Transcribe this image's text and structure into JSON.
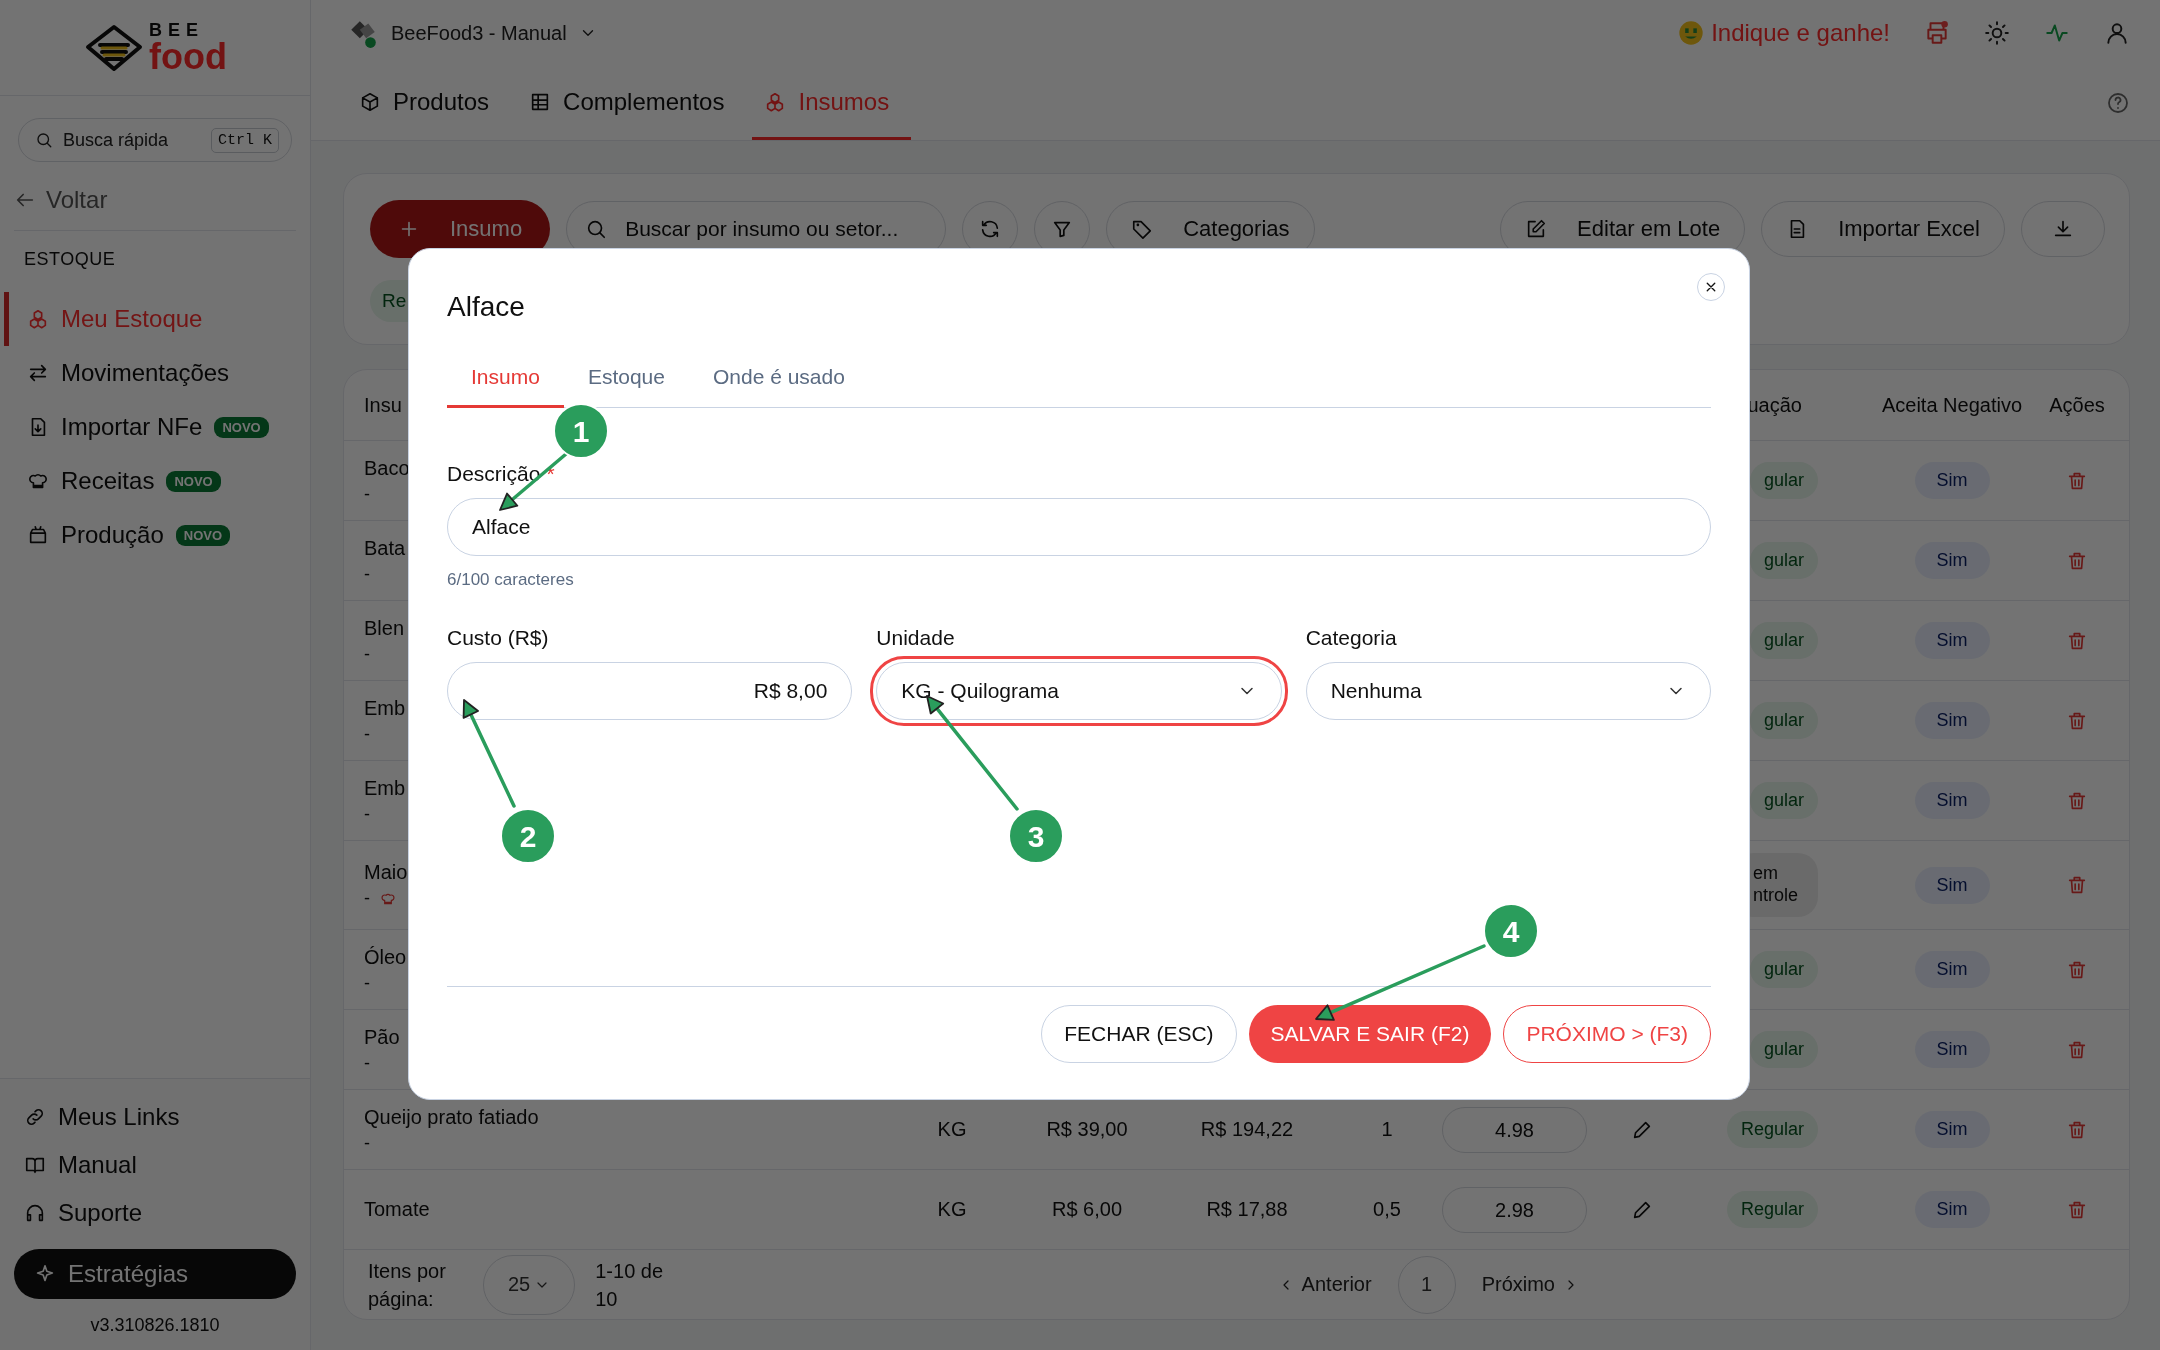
{
  "logo": {
    "top": "BEE",
    "bottom": "food"
  },
  "sidebar": {
    "search": {
      "placeholder": "Busca rápida",
      "shortcut": "Ctrl K"
    },
    "back": "Voltar",
    "section": "ESTOQUE",
    "items": [
      {
        "label": "Meu Estoque",
        "selected": true
      },
      {
        "label": "Movimentações",
        "selected": false
      },
      {
        "label": "Importar NFe",
        "badge": "NOVO",
        "selected": false
      },
      {
        "label": "Receitas",
        "badge": "NOVO",
        "selected": false
      },
      {
        "label": "Produção",
        "badge": "NOVO",
        "selected": false
      }
    ],
    "links": [
      {
        "label": "Meus Links"
      },
      {
        "label": "Manual"
      },
      {
        "label": "Suporte"
      }
    ],
    "cta": "Estratégias",
    "version": "v3.310826.1810"
  },
  "topbar": {
    "store": "BeeFood3 - Manual",
    "store_online": true,
    "referral": "Indique e ganhe!",
    "printer_alert": true
  },
  "tabs": [
    {
      "label": "Produtos",
      "selected": false
    },
    {
      "label": "Complementos",
      "selected": false
    },
    {
      "label": "Insumos",
      "selected": true
    }
  ],
  "toolbar": {
    "add_button": "Insumo",
    "search_placeholder": "Buscar por insumo ou setor...",
    "categories": "Categorias",
    "batch_edit": "Editar em Lote",
    "import": "Importar Excel",
    "chip": "Re"
  },
  "table": {
    "headers": {
      "column_1": "Insu",
      "column_8": "uação",
      "negative": "Aceita Negativo",
      "actions": "Ações"
    },
    "rows": [
      {
        "name": "Baco",
        "detail": "-",
        "status": {
          "text": "gular",
          "kind": "regular"
        },
        "negative": "Sim"
      },
      {
        "name": "Bata",
        "detail": "-",
        "status": {
          "text": "gular",
          "kind": "regular"
        },
        "negative": "Sim"
      },
      {
        "name": "Blen",
        "detail": "-",
        "status": {
          "text": "gular",
          "kind": "regular"
        },
        "negative": "Sim"
      },
      {
        "name": "Emb",
        "detail": "-",
        "status": {
          "text": "gular",
          "kind": "regular"
        },
        "negative": "Sim"
      },
      {
        "name": "Emb",
        "detail": "-",
        "status": {
          "text": "gular",
          "kind": "regular"
        },
        "negative": "Sim"
      },
      {
        "name": "Maio",
        "detail": "-",
        "recipe": true,
        "status": {
          "text": "em\nntrole",
          "kind": "none"
        },
        "negative": "Sim"
      },
      {
        "name": "Óleo",
        "detail": "-",
        "status": {
          "text": "gular",
          "kind": "regular"
        },
        "negative": "Sim"
      },
      {
        "name": "Pão",
        "detail": "-",
        "status": {
          "text": "gular",
          "kind": "regular"
        },
        "negative": "Sim"
      },
      {
        "name": "Queijo prato fatiado",
        "detail": "-",
        "unit": "KG",
        "cost": "R$ 39,00",
        "total": "R$ 194,22",
        "qty": "1",
        "stock": "4.98",
        "status": {
          "text": "Regular",
          "kind": "regular"
        },
        "negative": "Sim"
      },
      {
        "name": "Tomate",
        "unit": "KG",
        "cost": "R$ 6,00",
        "total": "R$ 17,88",
        "qty": "0,5",
        "stock": "2.98",
        "status": {
          "text": "Regular",
          "kind": "regular"
        },
        "negative": "Sim"
      }
    ]
  },
  "pagination": {
    "per_page_label": "Itens por página:",
    "per_page": "25",
    "range": "1-10 de 10",
    "prev": "Anterior",
    "page": "1",
    "next": "Próximo"
  },
  "modal": {
    "title": "Alface",
    "tabs": [
      {
        "label": "Insumo",
        "selected": true
      },
      {
        "label": "Estoque",
        "selected": false
      },
      {
        "label": "Onde é usado",
        "selected": false
      }
    ],
    "description": {
      "label": "Descrição",
      "required_mark": "*",
      "value": "Alface",
      "hint": "6/100 caracteres"
    },
    "fields": [
      {
        "label": "Custo (R$)",
        "kind": "money",
        "value": "R$ 8,00",
        "highlighted": false
      },
      {
        "label": "Unidade",
        "kind": "select",
        "value": "KG - Quilograma",
        "highlighted": true
      },
      {
        "label": "Categoria",
        "kind": "select",
        "value": "Nenhuma",
        "highlighted": false
      }
    ],
    "buttons": [
      {
        "label": "FECHAR (ESC)",
        "kind": "secondary"
      },
      {
        "label": "SALVAR E SAIR (F2)",
        "kind": "primary"
      },
      {
        "label": "PRÓXIMO > (F3)",
        "kind": "outline"
      }
    ]
  },
  "annotations": [
    {
      "label": "1"
    },
    {
      "label": "2"
    },
    {
      "label": "3"
    },
    {
      "label": "4"
    }
  ]
}
